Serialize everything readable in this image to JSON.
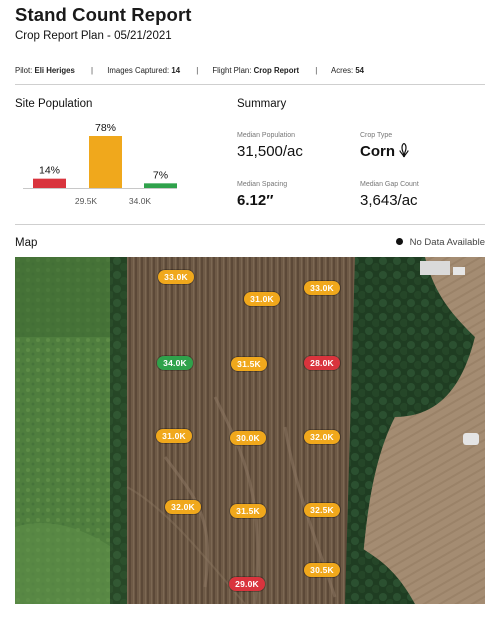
{
  "report": {
    "title": "Stand Count Report",
    "subtitle": "Crop Report Plan - 05/21/2021"
  },
  "meta": {
    "pilot_label": "Pilot:",
    "pilot_value": "Eli Heriges",
    "images_label": "Images Captured:",
    "images_value": "14",
    "flight_label": "Flight Plan:",
    "flight_value": "Crop Report",
    "acres_label": "Acres:",
    "acres_value": "54",
    "separator": "|"
  },
  "site_population": {
    "title": "Site Population",
    "chart_data": {
      "type": "bar",
      "categories": [
        "< 29.5K",
        "29.5K – 34.0K",
        "> 34.0K"
      ],
      "values": [
        14,
        78,
        7
      ],
      "value_labels": [
        "14%",
        "78%",
        "7%"
      ],
      "tick_labels": [
        "29.5K",
        "34.0K"
      ],
      "colors": [
        "#d9343d",
        "#f0a81c",
        "#2fa24b"
      ],
      "ylim": [
        0,
        100
      ]
    }
  },
  "summary": {
    "title": "Summary",
    "median_population_label": "Median Population",
    "median_population_value": "31,500/ac",
    "crop_type_label": "Crop Type",
    "crop_type_value": "Corn",
    "crop_icon": "corn-icon",
    "median_spacing_label": "Median Spacing",
    "median_spacing_value": "6.12″",
    "median_gap_label": "Median Gap Count",
    "median_gap_value": "3,643/ac"
  },
  "map": {
    "title": "Map",
    "legend_label": "No Data Available",
    "colors": {
      "low": "#d9343d",
      "mid": "#f0a81c",
      "high": "#2fa24b"
    },
    "samples": [
      {
        "label": "33.0K",
        "level": "mid"
      },
      {
        "label": "31.0K",
        "level": "mid"
      },
      {
        "label": "33.0K",
        "level": "mid"
      },
      {
        "label": "34.0K",
        "level": "high"
      },
      {
        "label": "31.5K",
        "level": "mid"
      },
      {
        "label": "28.0K",
        "level": "low"
      },
      {
        "label": "31.0K",
        "level": "mid"
      },
      {
        "label": "30.0K",
        "level": "mid"
      },
      {
        "label": "32.0K",
        "level": "mid"
      },
      {
        "label": "32.0K",
        "level": "mid"
      },
      {
        "label": "31.5K",
        "level": "mid"
      },
      {
        "label": "32.5K",
        "level": "mid"
      },
      {
        "label": "30.5K",
        "level": "mid"
      },
      {
        "label": "29.0K",
        "level": "low"
      }
    ]
  }
}
